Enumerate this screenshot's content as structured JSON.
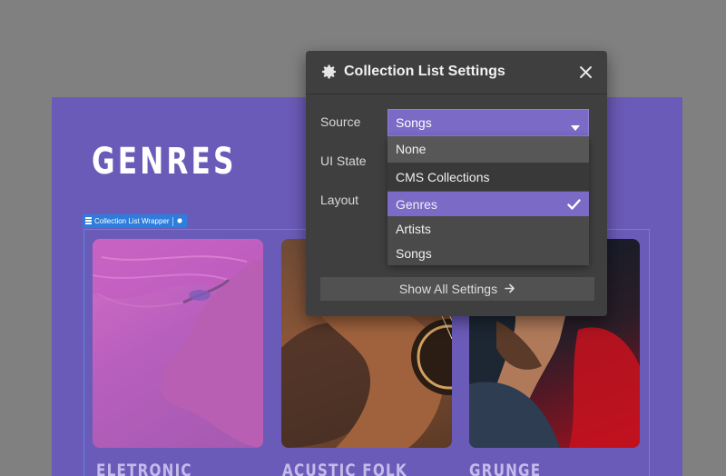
{
  "canvas": {
    "heading": "GENRES",
    "wrapper_tag": "Collection List Wrapper",
    "cards": [
      {
        "label": "ELETRONIC"
      },
      {
        "label": "ACUSTIC FOLK"
      },
      {
        "label": "GRUNGE"
      }
    ]
  },
  "panel": {
    "title": "Collection List Settings",
    "rows": {
      "source_label": "Source",
      "ui_state_label": "UI State",
      "layout_label": "Layout"
    },
    "source_value": "Songs",
    "dropdown": {
      "options": [
        "None",
        "CMS Collections",
        "Genres",
        "Artists",
        "Songs"
      ],
      "selected": "Genres"
    },
    "show_all_label": "Show All Settings"
  },
  "colors": {
    "canvas_bg": "#6b5bb8",
    "panel_bg": "#3f3f3f",
    "accent": "#7b6ac6",
    "selection_blue": "#2e7ddc"
  },
  "icons": [
    "gear-icon",
    "close-icon",
    "caret-down-icon",
    "check-icon",
    "arrow-right-icon",
    "collection-icon",
    "settings-small-icon"
  ]
}
